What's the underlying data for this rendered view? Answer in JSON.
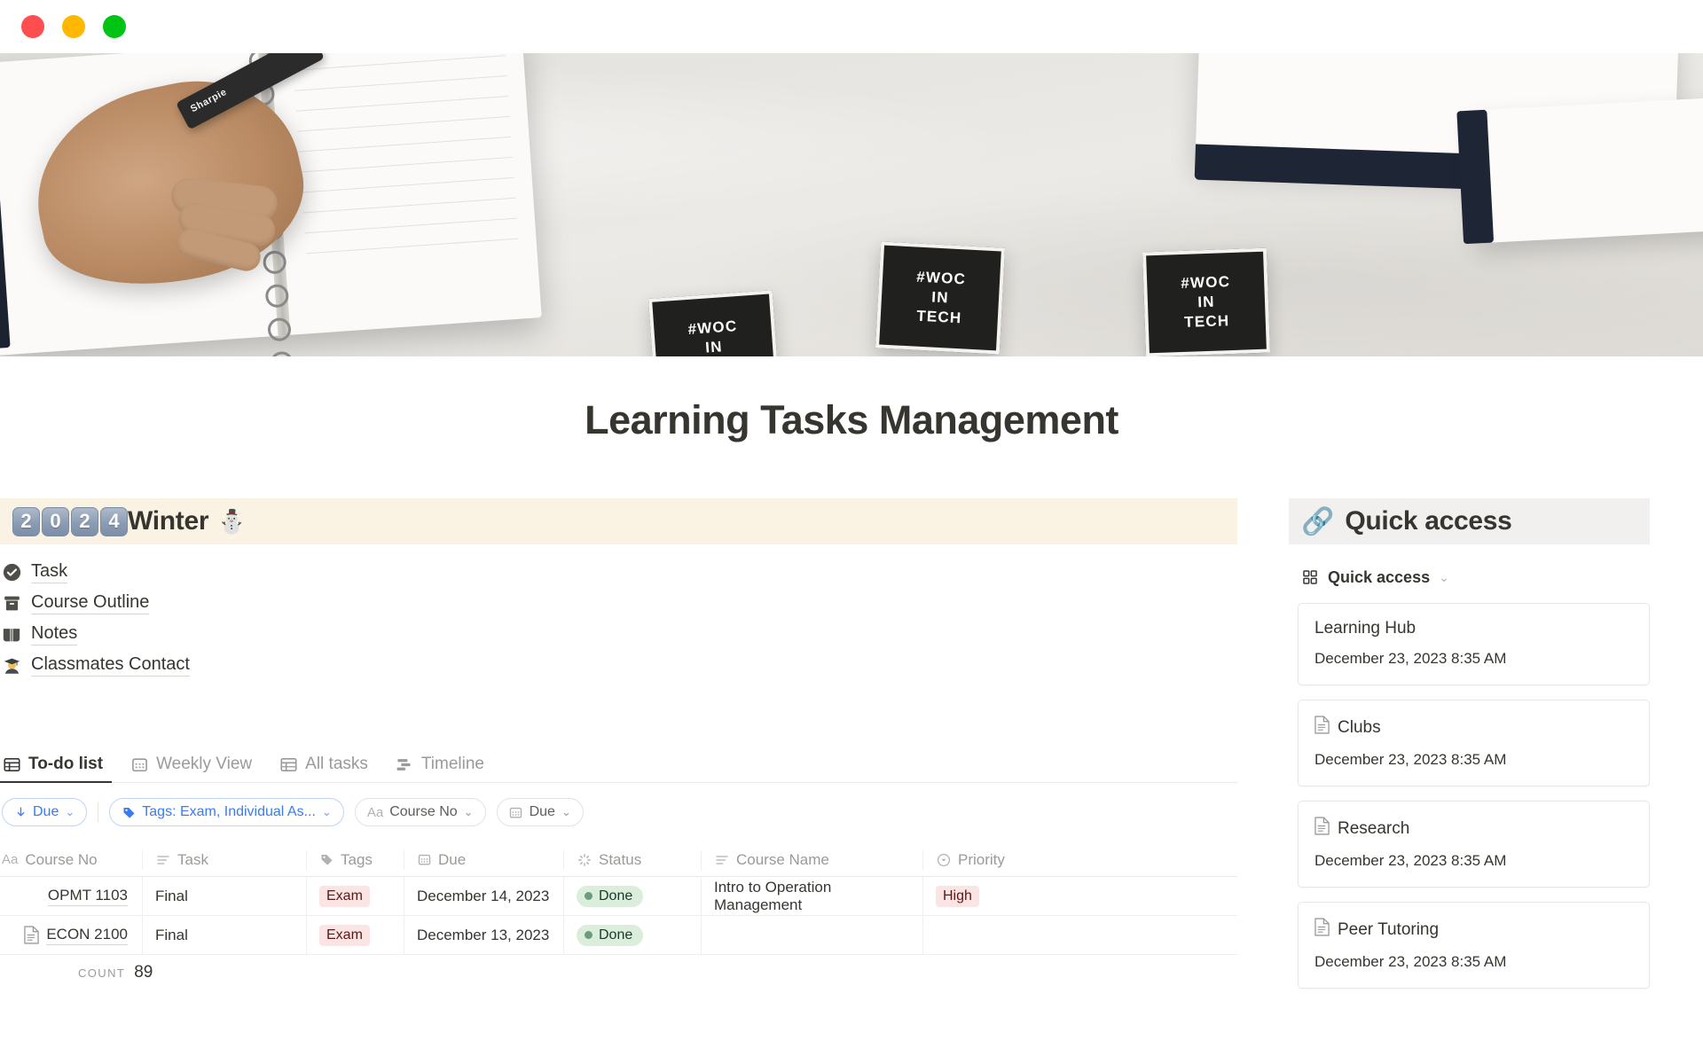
{
  "window": {
    "buttons": [
      {
        "name": "close",
        "color": "#ff4e50"
      },
      {
        "name": "minimize",
        "color": "#ffb701"
      },
      {
        "name": "maximize",
        "color": "#00c413"
      }
    ]
  },
  "cover": {
    "sticker_lines": [
      "#WOC",
      "IN",
      "TECH"
    ],
    "marker_label": "Sharpie"
  },
  "page": {
    "title": "Learning Tasks Management"
  },
  "callout": {
    "year_digits": [
      "2",
      "0",
      "2",
      "4"
    ],
    "season": "Winter",
    "emoji": "⛄"
  },
  "links": [
    {
      "icon": "check-circle-icon",
      "label": "Task"
    },
    {
      "icon": "archive-box-icon",
      "label": "Course Outline"
    },
    {
      "icon": "open-book-icon",
      "label": "Notes"
    },
    {
      "icon": "graduate-icon",
      "label": "Classmates Contact"
    }
  ],
  "tabs": [
    {
      "icon": "table-icon",
      "label": "To-do list",
      "active": true
    },
    {
      "icon": "calendar-icon",
      "label": "Weekly View",
      "active": false
    },
    {
      "icon": "table-icon",
      "label": "All tasks",
      "active": false
    },
    {
      "icon": "timeline-icon",
      "label": "Timeline",
      "active": false
    }
  ],
  "filters": [
    {
      "icon": "arrow-down-icon",
      "label": "Due",
      "accent": "#3a7cf0",
      "active": true
    },
    {
      "icon": "tag-icon",
      "label": "Tags: Exam, Individual As...",
      "accent": "#3a7cf0",
      "active": true
    },
    {
      "icon": "text-aa-icon",
      "label": "Course No",
      "accent": "#605d59",
      "active": false
    },
    {
      "icon": "calendar-icon",
      "label": "Due",
      "accent": "#605d59",
      "active": false
    }
  ],
  "table": {
    "columns": [
      {
        "icon": "text-aa-icon",
        "label": "Course No"
      },
      {
        "icon": "text-lines-icon",
        "label": "Task"
      },
      {
        "icon": "tag-icon",
        "label": "Tags"
      },
      {
        "icon": "calendar-icon",
        "label": "Due"
      },
      {
        "icon": "status-spinner-icon",
        "label": "Status"
      },
      {
        "icon": "text-lines-icon",
        "label": "Course Name"
      },
      {
        "icon": "select-circle-icon",
        "label": "Priority"
      }
    ],
    "rows": [
      {
        "course_no": "OPMT 1103",
        "has_doc_icon": false,
        "task": "Final",
        "tag": "Exam",
        "due": "December 14, 2023",
        "status": "Done",
        "course_name": "Intro to Operation Management",
        "priority": "High"
      },
      {
        "course_no": "ECON 2100",
        "has_doc_icon": true,
        "task": "Final",
        "tag": "Exam",
        "due": "December 13, 2023",
        "status": "Done",
        "course_name": "",
        "priority": ""
      }
    ],
    "footer": {
      "label": "COUNT",
      "value": "89"
    }
  },
  "quick_access": {
    "banner_emoji": "🔗",
    "banner_title": "Quick access",
    "section_label": "Quick access",
    "cards": [
      {
        "title": "Learning Hub",
        "date": "December 23, 2023 8:35 AM",
        "has_doc_icon": false
      },
      {
        "title": "Clubs",
        "date": "December 23, 2023 8:35 AM",
        "has_doc_icon": true
      },
      {
        "title": "Research",
        "date": "December 23, 2023 8:35 AM",
        "has_doc_icon": true
      },
      {
        "title": "Peer Tutoring",
        "date": "December 23, 2023 8:35 AM",
        "has_doc_icon": true
      }
    ]
  },
  "colors": {
    "callout_bg": "#faf3e3",
    "banner_bg": "#f1f0ee",
    "accent_blue": "#3a7cf0",
    "tag_red_bg": "#fbe4e4",
    "status_green_bg": "#dbeddb"
  }
}
